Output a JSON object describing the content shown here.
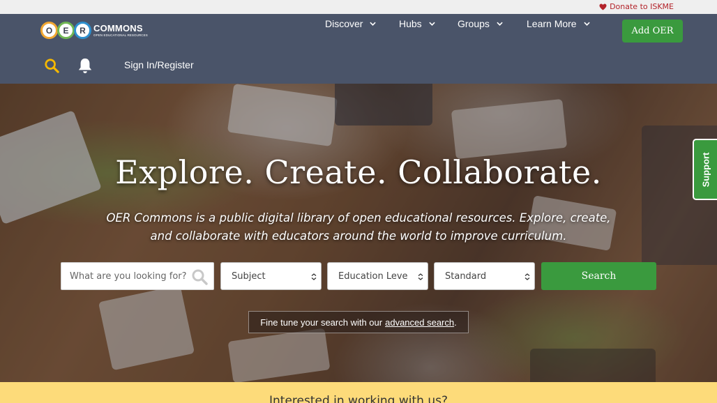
{
  "utility_bar": {
    "donate_label": "Donate to ISKME"
  },
  "header": {
    "logo": {
      "letters": [
        "O",
        "E",
        "R"
      ],
      "word": "COMMONS",
      "subtitle": "OPEN EDUCATIONAL RESOURCES"
    },
    "nav": [
      {
        "label": "Discover"
      },
      {
        "label": "Hubs"
      },
      {
        "label": "Groups"
      },
      {
        "label": "Learn More"
      }
    ],
    "add_oer_label": "Add OER",
    "signin_label": "Sign In/Register",
    "icons": [
      "search-icon",
      "bell-icon",
      "chevron-down-icon",
      "heart-icon"
    ]
  },
  "hero": {
    "title": "Explore. Create. Collaborate.",
    "subtitle": "OER Commons is a public digital library of open educational resources. Explore, create, and collaborate with educators around the world to improve curriculum.",
    "search": {
      "placeholder": "What are you looking for?",
      "value": "",
      "button_label": "Search"
    },
    "filters": [
      {
        "selected": "Subject"
      },
      {
        "selected": "Education Leve"
      },
      {
        "selected": "Standard"
      }
    ],
    "finetune": {
      "text": "Fine tune your search with our",
      "link": "advanced search",
      "suffix": "."
    }
  },
  "support_label": "Support",
  "bottom_banner": {
    "text": "Interested in working with us?"
  },
  "colors": {
    "header_bg": "#4a5469",
    "accent_green": "#3a9a3e",
    "donate_red": "#b3232a",
    "banner_yellow": "#fddb7a",
    "icon_yellow": "#f5b800"
  }
}
